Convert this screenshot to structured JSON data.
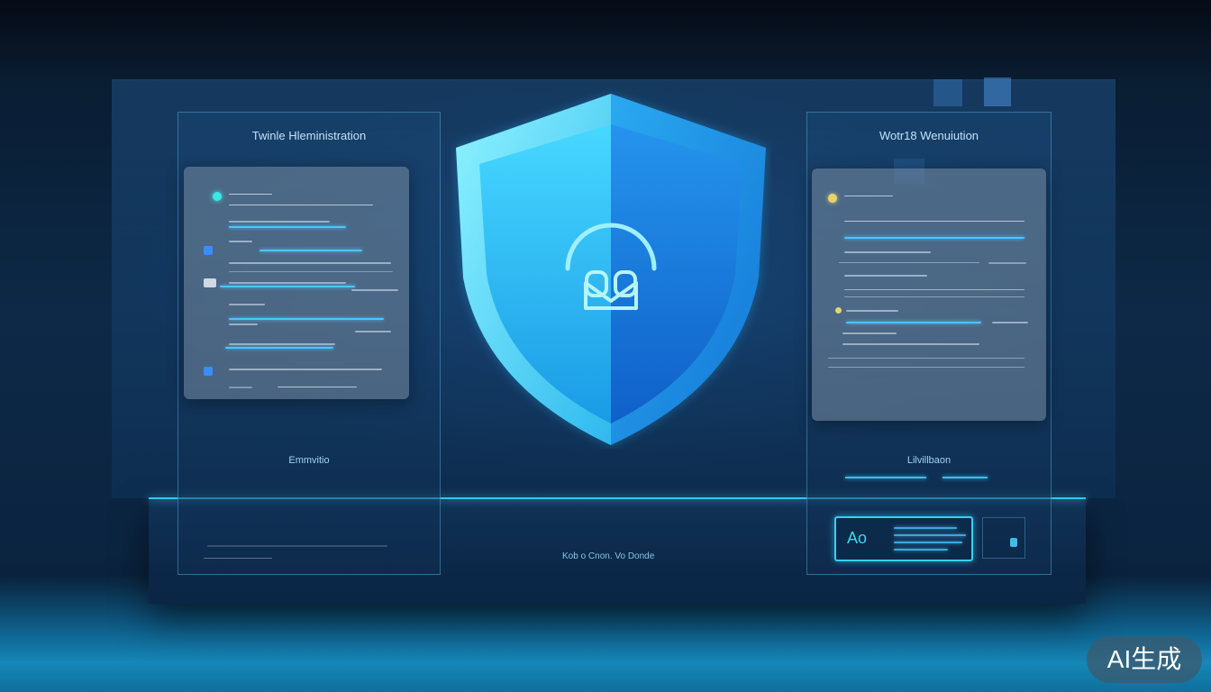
{
  "left_panel": {
    "title": "Twinle Hleministration",
    "footer": "Emmvitio"
  },
  "right_panel": {
    "title": "Wotr18 Wenuiution",
    "footer": "Lilvillbaon"
  },
  "bottom_center_caption": "Kob o Cnon. Vo Donde",
  "lock_widget": {
    "code": "Ao"
  },
  "watermark": "AI生成",
  "colors": {
    "accent": "#3fd0ff",
    "shield_light": "#5fe0ff",
    "shield_dark": "#1670d8",
    "background": "#0b2440"
  },
  "icons": {
    "shield": "shield-icon",
    "lock": "lock-icon"
  }
}
